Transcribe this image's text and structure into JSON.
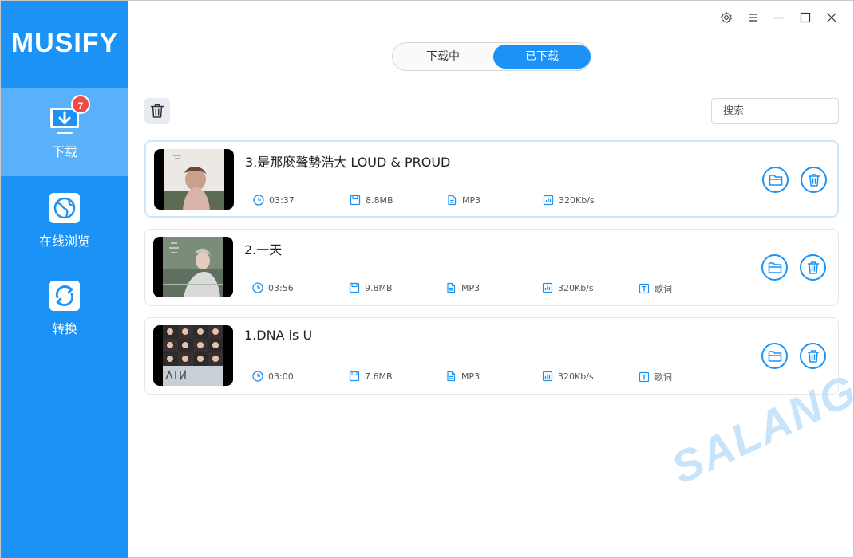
{
  "app": {
    "logo": "MUSIFY"
  },
  "sidebar": {
    "items": [
      {
        "label": "下载",
        "icon": "download-monitor-icon",
        "badge": "7",
        "active": true
      },
      {
        "label": "在线浏览",
        "icon": "globe-icon",
        "active": false
      },
      {
        "label": "转换",
        "icon": "convert-icon",
        "active": false
      }
    ]
  },
  "window_controls": [
    "settings-icon",
    "menu-icon",
    "minimize-icon",
    "maximize-icon",
    "close-icon"
  ],
  "tabs": [
    {
      "label": "下载中",
      "active": false
    },
    {
      "label": "已下载",
      "active": true
    }
  ],
  "toolbar": {
    "delete_all_icon": "trash-icon"
  },
  "search": {
    "placeholder": "搜索",
    "value": ""
  },
  "songs": [
    {
      "title": "3.是那麼聱勢浩大 LOUD & PROUD",
      "duration": "03:37",
      "size": "8.8MB",
      "format": "MP3",
      "bitrate": "320Kb/s",
      "lyrics": "",
      "selected": true
    },
    {
      "title": "2.一天",
      "duration": "03:56",
      "size": "9.8MB",
      "format": "MP3",
      "bitrate": "320Kb/s",
      "lyrics": "歌词",
      "selected": false
    },
    {
      "title": "1.DNA is U",
      "duration": "03:00",
      "size": "7.6MB",
      "format": "MP3",
      "bitrate": "320Kb/s",
      "lyrics": "歌词",
      "selected": false
    }
  ],
  "watermark": "SALANGHE",
  "colors": {
    "accent": "#1a92f6",
    "sidebar_active": "#58b1fa",
    "badge": "#f24a4a",
    "selected_border": "#cde7fb"
  }
}
